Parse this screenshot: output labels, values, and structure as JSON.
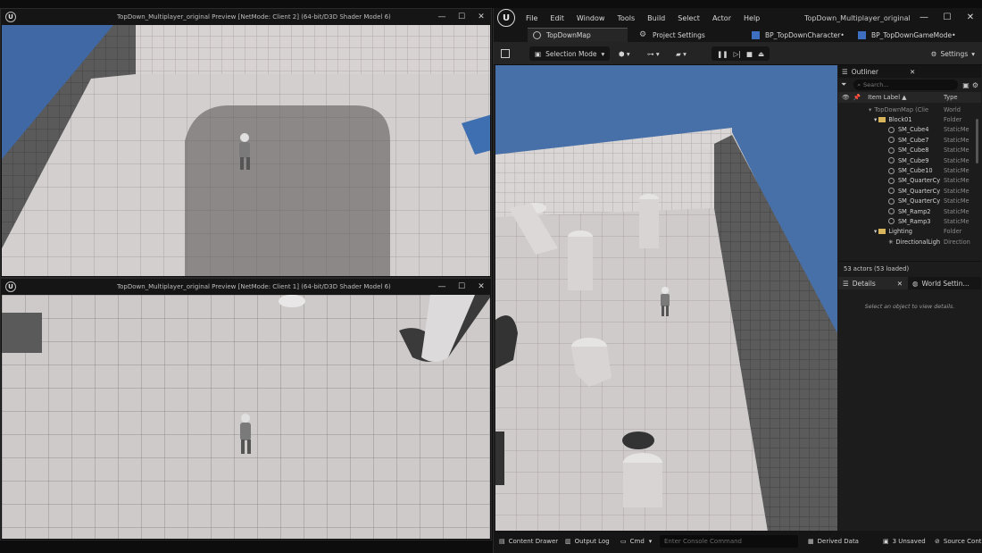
{
  "client2_window": {
    "title": "TopDown_Multiplayer_original Preview [NetMode: Client 2]  (64-bit/D3D Shader Model 6)",
    "controls": [
      "—",
      "☐",
      "✕"
    ]
  },
  "client1_window": {
    "title": "TopDown_Multiplayer_original Preview [NetMode: Client 1]  (64-bit/D3D Shader Model 6)",
    "controls": [
      "—",
      "☐",
      "✕"
    ]
  },
  "editor": {
    "title": "TopDown_Multiplayer_original",
    "menu": [
      "File",
      "Edit",
      "Window",
      "Tools",
      "Build",
      "Select",
      "Actor",
      "Help"
    ],
    "window_controls": [
      "—",
      "☐",
      "✕"
    ],
    "tabs": [
      {
        "label": "TopDownMap"
      },
      {
        "label": "Project Settings"
      },
      {
        "label": "BP_TopDownCharacter•"
      },
      {
        "label": "BP_TopDownGameMode•"
      }
    ],
    "toolbar": {
      "selection_mode": "Selection Mode",
      "settings": "Settings"
    },
    "outliner": {
      "title": "Outliner",
      "search_placeholder": "Search...",
      "col_label": "Item Label ▲",
      "col_type": "Type",
      "rows": [
        {
          "label": "TopDownMap (Clie",
          "type": "World"
        },
        {
          "label": "Block01",
          "type": "Folder"
        },
        {
          "label": "SM_Cube4",
          "type": "StaticMe"
        },
        {
          "label": "SM_Cube7",
          "type": "StaticMe"
        },
        {
          "label": "SM_Cube8",
          "type": "StaticMe"
        },
        {
          "label": "SM_Cube9",
          "type": "StaticMe"
        },
        {
          "label": "SM_Cube10",
          "type": "StaticMe"
        },
        {
          "label": "SM_QuarterCy",
          "type": "StaticMe"
        },
        {
          "label": "SM_QuarterCy",
          "type": "StaticMe"
        },
        {
          "label": "SM_QuarterCy",
          "type": "StaticMe"
        },
        {
          "label": "SM_Ramp2",
          "type": "StaticMe"
        },
        {
          "label": "SM_Ramp3",
          "type": "StaticMe"
        },
        {
          "label": "Lighting",
          "type": "Folder"
        },
        {
          "label": "DirectionalLigh",
          "type": "Direction"
        }
      ],
      "footer": "53 actors (53 loaded)"
    },
    "details": {
      "tab_details": "Details",
      "tab_world": "World Settin...",
      "empty_text": "Select an object to view details."
    },
    "statusbar": {
      "content_drawer": "Content Drawer",
      "output_log": "Output Log",
      "cmd": "Cmd",
      "console_placeholder": "Enter Console Command",
      "derived_data": "Derived Data",
      "unsaved": "3 Unsaved",
      "source_control": "Source Cont"
    }
  },
  "colors": {
    "sky": "#4870a8",
    "floor": "#cfcaca",
    "wall": "#5d5d5d",
    "panel": "#1c1c1c",
    "accent_folder": "#d8b45a"
  }
}
